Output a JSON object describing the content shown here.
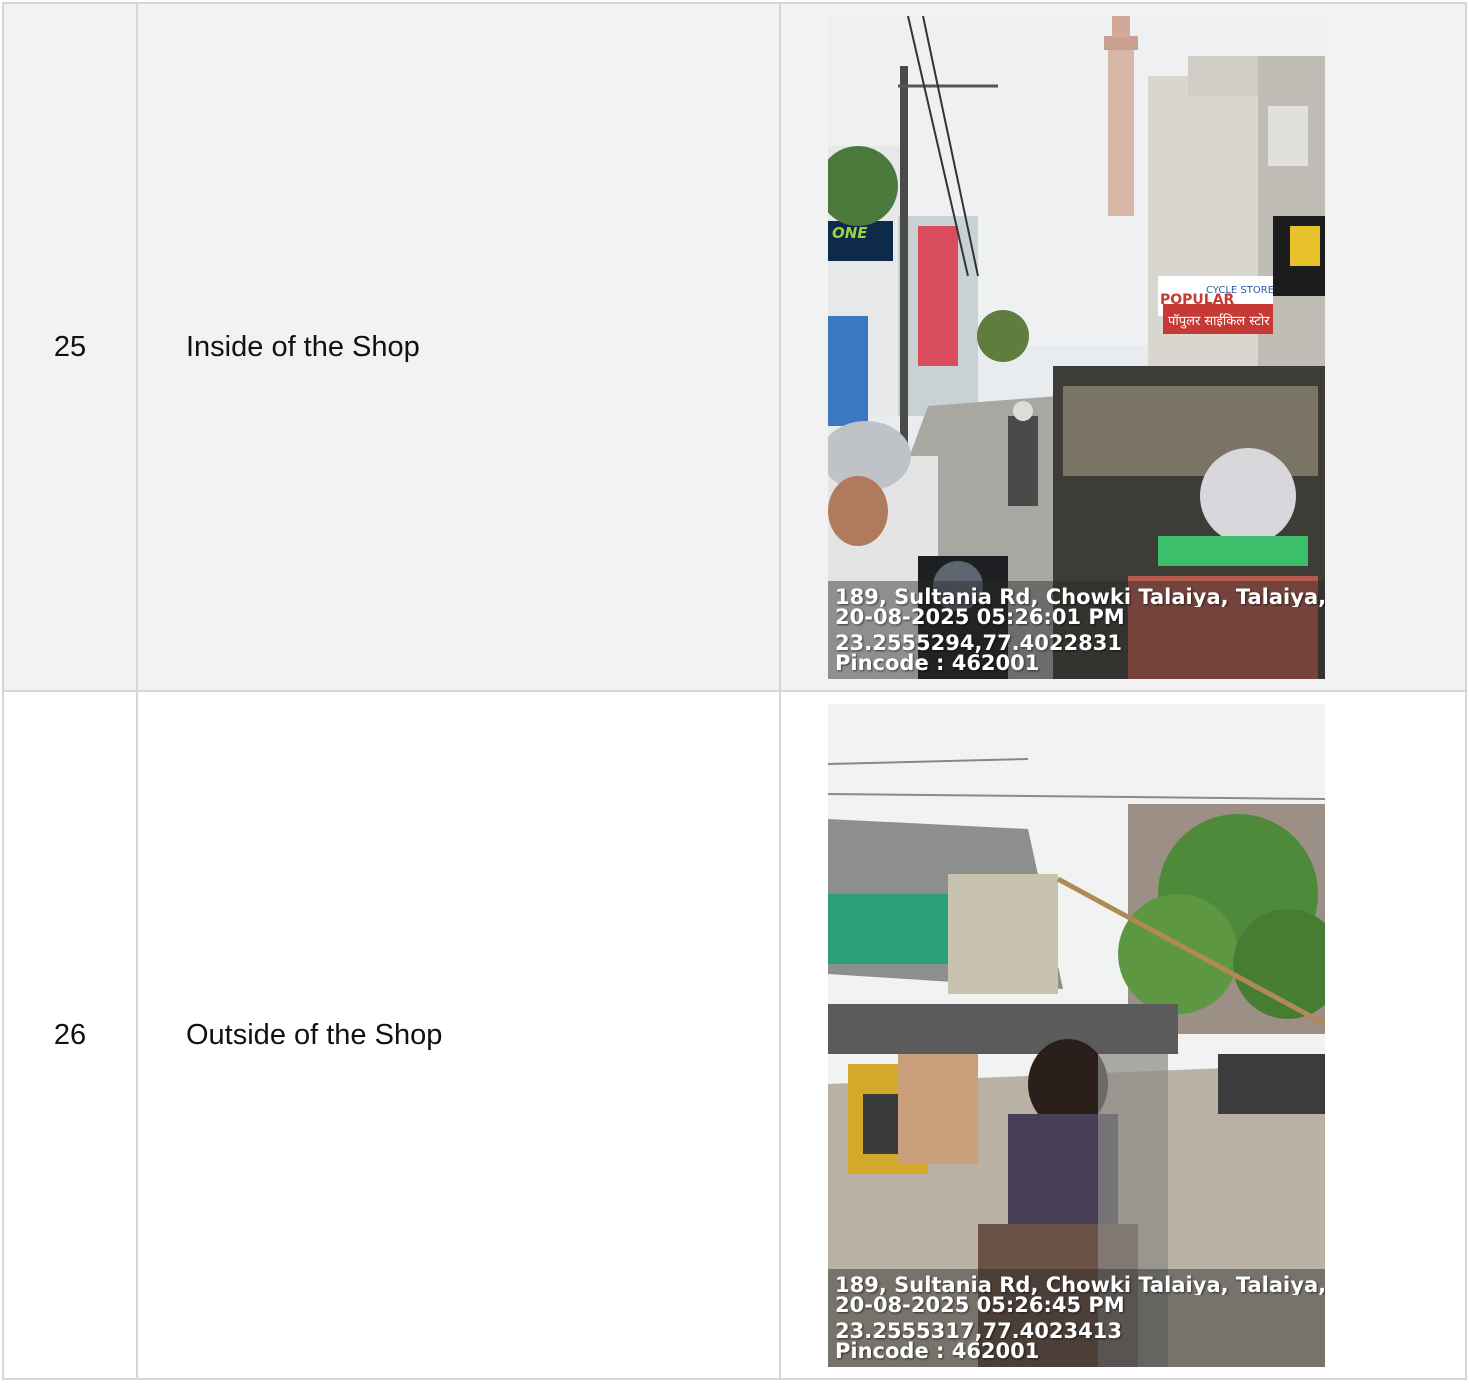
{
  "rows": [
    {
      "number": "25",
      "description": "Inside of the Shop",
      "photo": {
        "address": "189, Sultania Rd, Chowki Talaiya, Talaiya, ...",
        "datetime": "20-08-2025 05:26:01 PM",
        "coords": "23.2555294,77.4022831",
        "pincode": "Pincode : 462001"
      }
    },
    {
      "number": "26",
      "description": "Outside of the Shop",
      "photo": {
        "address": "189, Sultania Rd, Chowki Talaiya, Talaiya, ...",
        "datetime": "20-08-2025 05:26:45 PM",
        "coords": "23.2555317,77.4023413",
        "pincode": "Pincode : 462001"
      }
    }
  ],
  "photo_signs": {
    "one": "ONE",
    "popular": "POPULAR",
    "cycle_store": "CYCLE STORE",
    "hindi_sign": "पॉपुलर साईकिल स्टोर"
  }
}
